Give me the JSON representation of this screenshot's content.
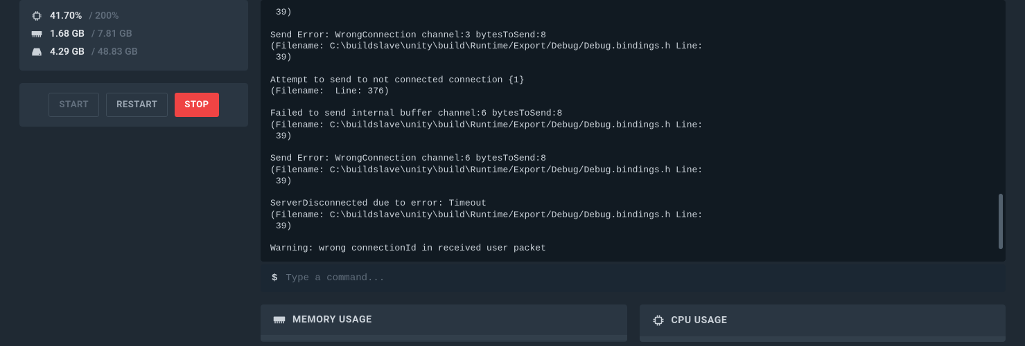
{
  "sidebar": {
    "stats": {
      "cpu": {
        "value": "41.70%",
        "max": "200%"
      },
      "memory": {
        "value": "1.68 GB",
        "max": "7.81 GB"
      },
      "disk": {
        "value": "4.29 GB",
        "max": "48.83 GB"
      }
    },
    "controls": {
      "start": "START",
      "restart": "RESTART",
      "stop": "STOP"
    }
  },
  "console": {
    "log": " 39)\n\nSend Error: WrongConnection channel:3 bytesToSend:8\n(Filename: C:\\buildslave\\unity\\build\\Runtime/Export/Debug/Debug.bindings.h Line:\n 39)\n\nAttempt to send to not connected connection {1}\n(Filename:  Line: 376)\n\nFailed to send internal buffer channel:6 bytesToSend:8\n(Filename: C:\\buildslave\\unity\\build\\Runtime/Export/Debug/Debug.bindings.h Line:\n 39)\n\nSend Error: WrongConnection channel:6 bytesToSend:8\n(Filename: C:\\buildslave\\unity\\build\\Runtime/Export/Debug/Debug.bindings.h Line:\n 39)\n\nServerDisconnected due to error: Timeout\n(Filename: C:\\buildslave\\unity\\build\\Runtime/Export/Debug/Debug.bindings.h Line:\n 39)\n\nWarning: wrong connectionId in received user packet",
    "prompt": "$",
    "placeholder": "Type a command..."
  },
  "charts": {
    "memory_title": "MEMORY USAGE",
    "cpu_title": "CPU USAGE"
  }
}
